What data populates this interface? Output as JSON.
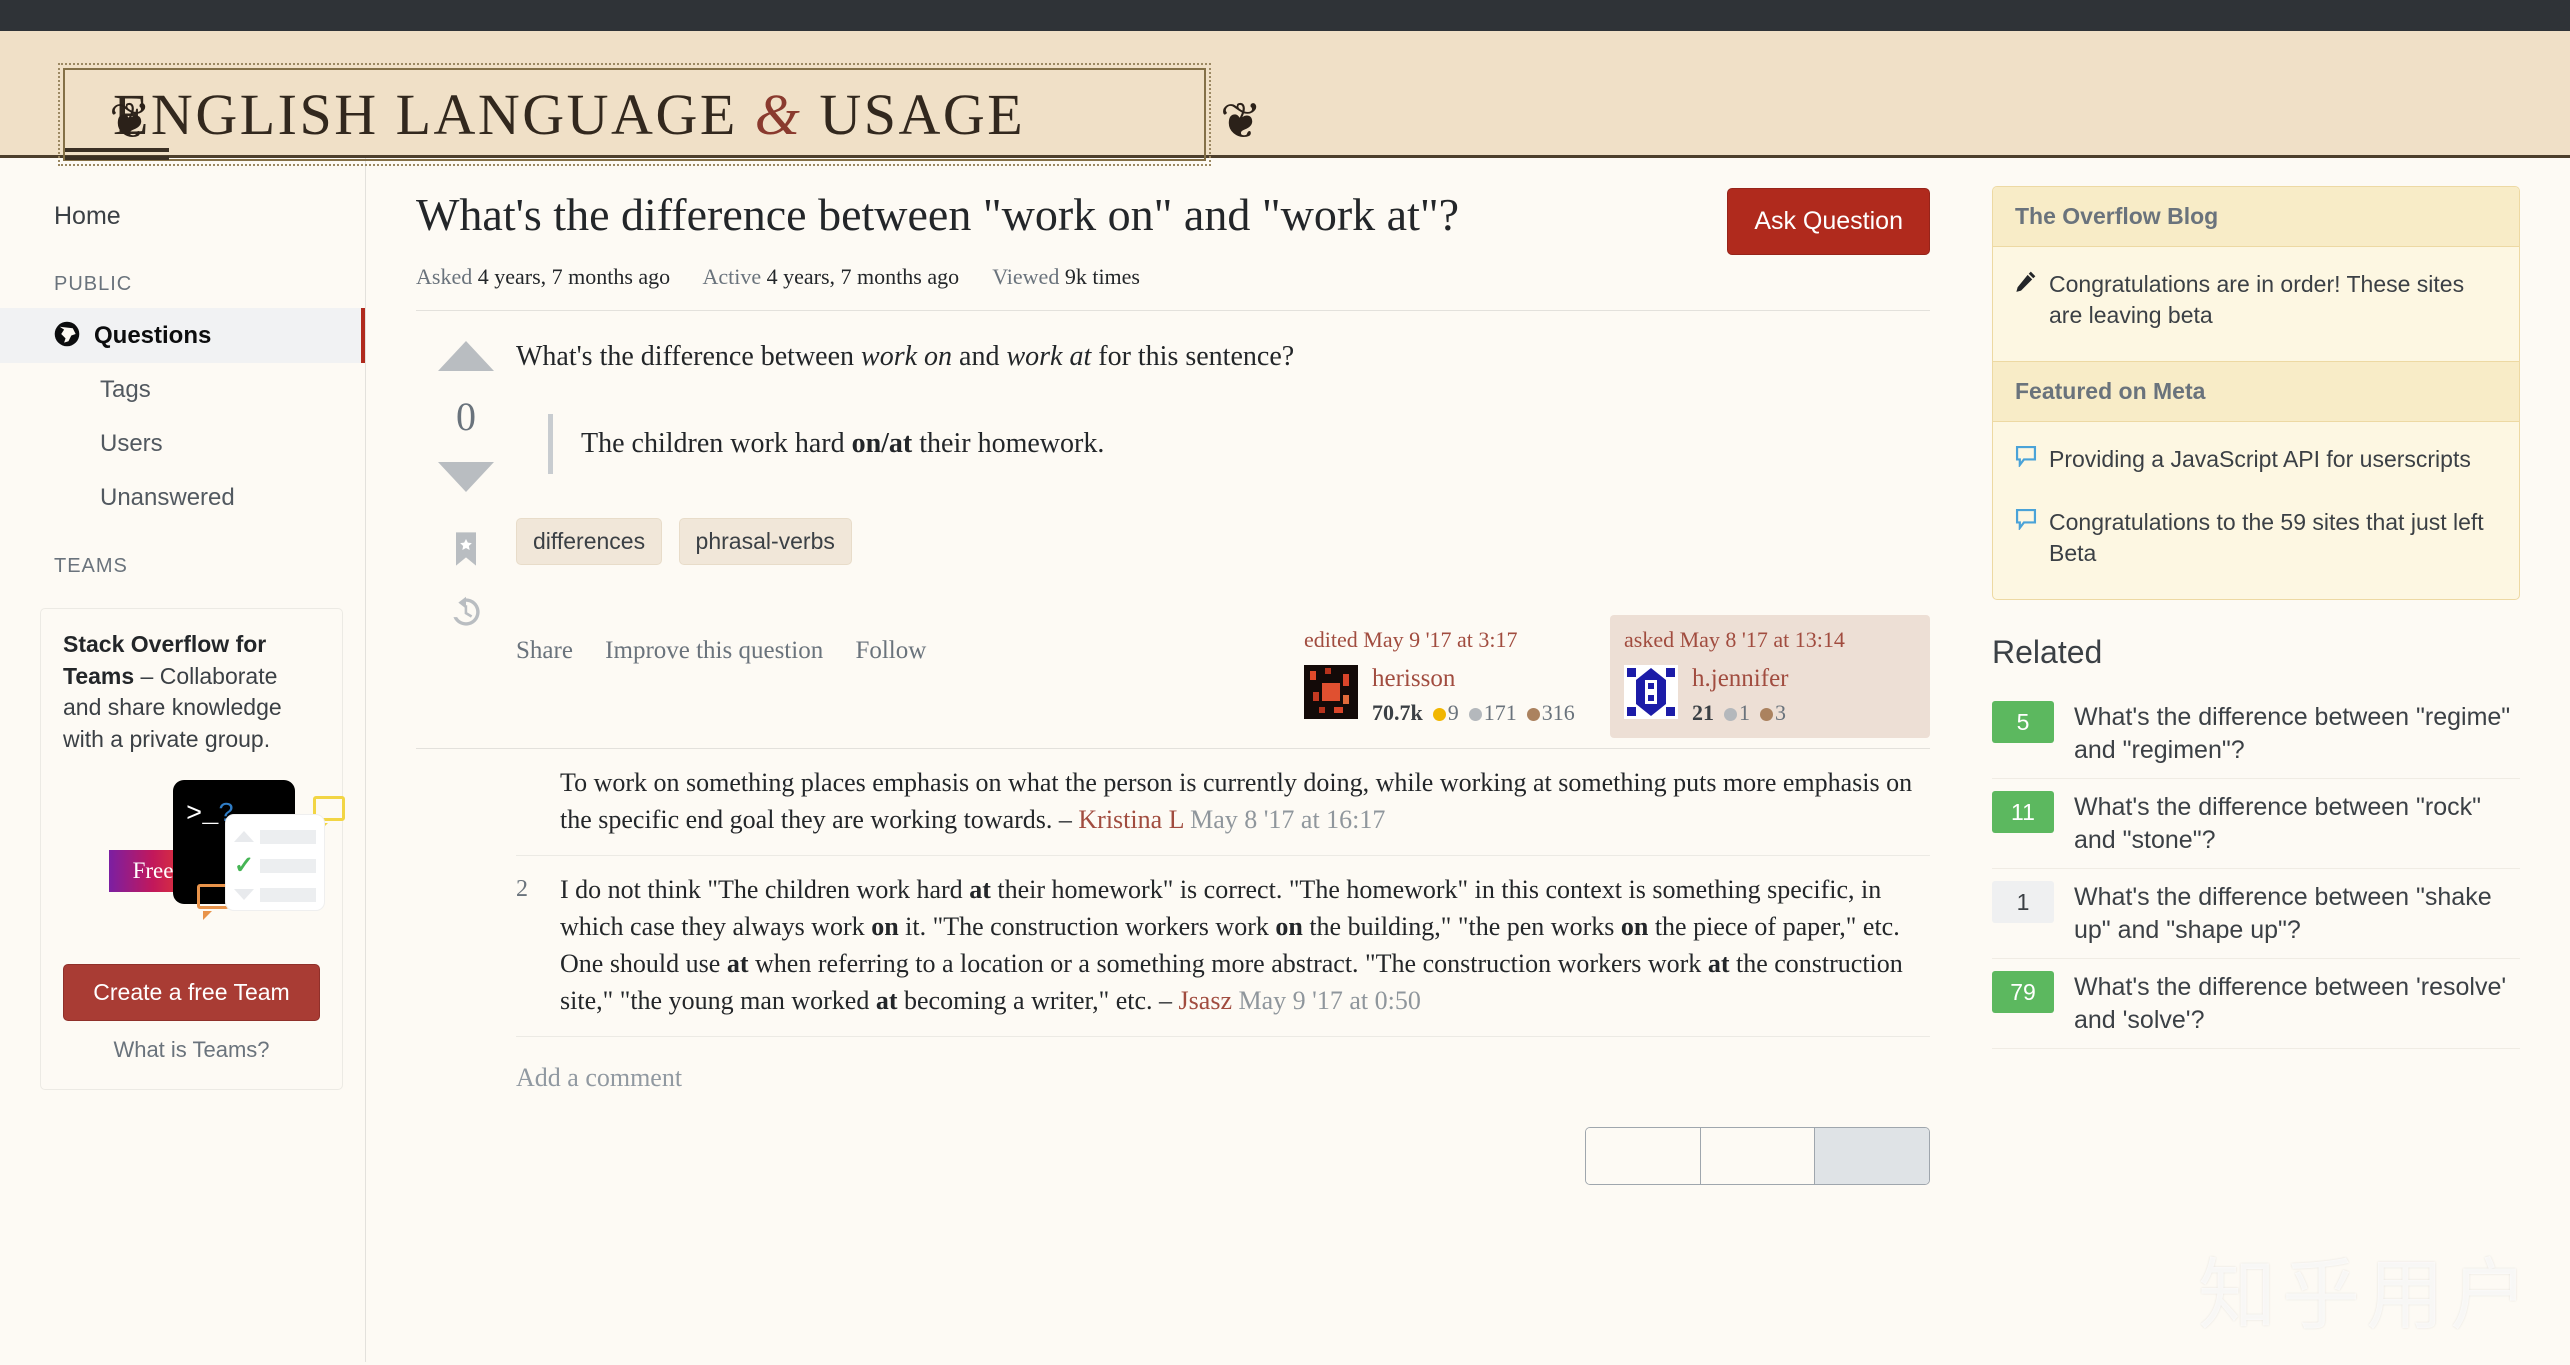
{
  "site": {
    "banner_title_part1": "ENGLISH LANGUAGE",
    "banner_amp": "&",
    "banner_title_part2": "USAGE",
    "fleuron_left": "❦",
    "fleuron_right": "❦"
  },
  "sidebar": {
    "home_label": "Home",
    "public_label": "PUBLIC",
    "teams_label": "TEAMS",
    "items": [
      {
        "label": "Questions",
        "icon": "globe-icon",
        "active": true
      },
      {
        "label": "Tags",
        "active": false
      },
      {
        "label": "Users",
        "active": false
      },
      {
        "label": "Unanswered",
        "active": false
      }
    ],
    "teams_card": {
      "title": "Stack Overflow for Teams",
      "dash": " – ",
      "body": "Collaborate and share knowledge with a private group.",
      "art_prompt": ">_",
      "art_question": "?",
      "art_free": "Free",
      "cta_label": "Create a free Team",
      "link_label": "What is Teams?"
    }
  },
  "question": {
    "title": "What's the difference between \"work on\" and \"work at\"?",
    "meta": {
      "asked_label": "Asked",
      "asked_value": "4 years, 7 months ago",
      "active_label": "Active",
      "active_value": "4 years, 7 months ago",
      "viewed_label": "Viewed",
      "viewed_value": "9k times"
    },
    "ask_button": "Ask Question",
    "vote_count": "0",
    "body_text_1": "What's the difference between ",
    "body_em_1": "work on",
    "body_text_2": " and ",
    "body_em_2": "work at",
    "body_text_3": " for this sentence?",
    "quote_pre": "The children work hard ",
    "quote_bold": "on/at",
    "quote_post": " their homework.",
    "tags": [
      "differences",
      "phrasal-verbs"
    ],
    "actions": [
      "Share",
      "Improve this question",
      "Follow"
    ],
    "edited": {
      "date_label": "edited May 9 '17 at 3:17",
      "user": "herisson",
      "rep": "70.7k",
      "gold": "9",
      "silver": "171",
      "bronze": "316"
    },
    "asked": {
      "date_label": "asked May 8 '17 at 13:14",
      "user": "h.jennifer",
      "rep": "21",
      "silver": "1",
      "bronze": "3"
    }
  },
  "comments": [
    {
      "score": "",
      "text": "To work on something places emphasis on what the person is currently doing, while working at something puts more emphasis on the specific end goal they are working towards. – ",
      "author": "Kristina L",
      "date": " May 8 '17 at 16:17"
    },
    {
      "score": "2",
      "text_parts": [
        {
          "t": "I do not think \"The children work hard "
        },
        {
          "b": "at"
        },
        {
          "t": " their homework\" is correct. \"The homework\" in this context is something specific, in which case they always work "
        },
        {
          "b": "on"
        },
        {
          "t": " it. \"The construction workers work "
        },
        {
          "b": "on"
        },
        {
          "t": " the building,\" \"the pen works "
        },
        {
          "b": "on"
        },
        {
          "t": " the piece of paper,\" etc. One should use "
        },
        {
          "b": "at"
        },
        {
          "t": " when referring to a location or a something more abstract. \"The construction workers work "
        },
        {
          "b": "at"
        },
        {
          "t": " the construction site,\" \"the young man worked "
        },
        {
          "b": "at"
        },
        {
          "t": " becoming a writer,\" etc. – "
        }
      ],
      "author": "Jsasz",
      "date": " May 9 '17 at 0:50"
    }
  ],
  "add_comment_label": "Add a comment",
  "blog": {
    "header_1": "The Overflow Blog",
    "items_1": [
      {
        "icon": "pencil-icon",
        "text": "Congratulations are in order! These sites are leaving beta"
      }
    ],
    "header_2": "Featured on Meta",
    "items_2": [
      {
        "icon": "speech-bubble-icon",
        "text": "Providing a JavaScript API for userscripts"
      },
      {
        "icon": "speech-bubble-icon",
        "text": "Congratulations to the 59 sites that just left Beta"
      }
    ]
  },
  "related": {
    "heading": "Related",
    "items": [
      {
        "score": "5",
        "title": "What's the difference between \"regime\" and \"regimen\"?",
        "zero": false
      },
      {
        "score": "11",
        "title": "What's the difference between \"rock\" and \"stone\"?",
        "zero": false
      },
      {
        "score": "1",
        "title": "What's the difference between \"shake up\" and \"shape up\"?",
        "zero": true
      },
      {
        "score": "79",
        "title": "What's the difference between 'resolve' and 'solve'?",
        "zero": false
      }
    ]
  },
  "watermark": "知乎用户",
  "colors": {
    "banner_bg": "#f0e0c7",
    "accent_red": "#b02a1d",
    "page_bg": "#fdfaf4",
    "blog_bg": "#fdf7e2",
    "score_green": "#5cb85f"
  }
}
